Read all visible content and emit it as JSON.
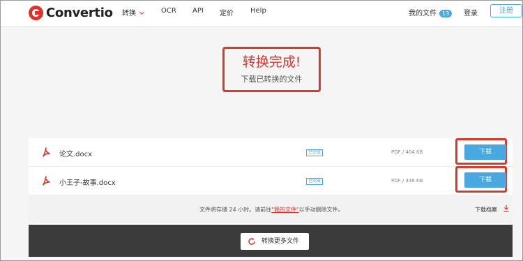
{
  "header": {
    "logo_text": "Convertio",
    "nav": {
      "convert": "转换",
      "ocr": "OCR",
      "api": "API",
      "pricing": "定价",
      "help": "Help"
    },
    "my_files": "我的文件",
    "my_files_count": "13",
    "login": "登录",
    "signup": "注册"
  },
  "hero": {
    "title": "转换完成!",
    "subtitle": "下载已转换的文件"
  },
  "files": [
    {
      "name": "论文.docx",
      "status": "已完成",
      "meta": "PDF / 404 KB",
      "download": "下载"
    },
    {
      "name": "小王子-故事.docx",
      "status": "已完成",
      "meta": "PDF / 446 KB",
      "download": "下载"
    }
  ],
  "notice": {
    "before": "文件将存储 24 小时。请前往",
    "link": "\"我的文件\"",
    "after": "以手动删除文件。",
    "archive": "下载档案"
  },
  "more_button": "转换更多文件",
  "colors": {
    "brand_red": "#e0322b",
    "accent_blue": "#4aa8e0",
    "highlight_red": "#d93a2a",
    "dark_bar": "#3b3b3b"
  }
}
